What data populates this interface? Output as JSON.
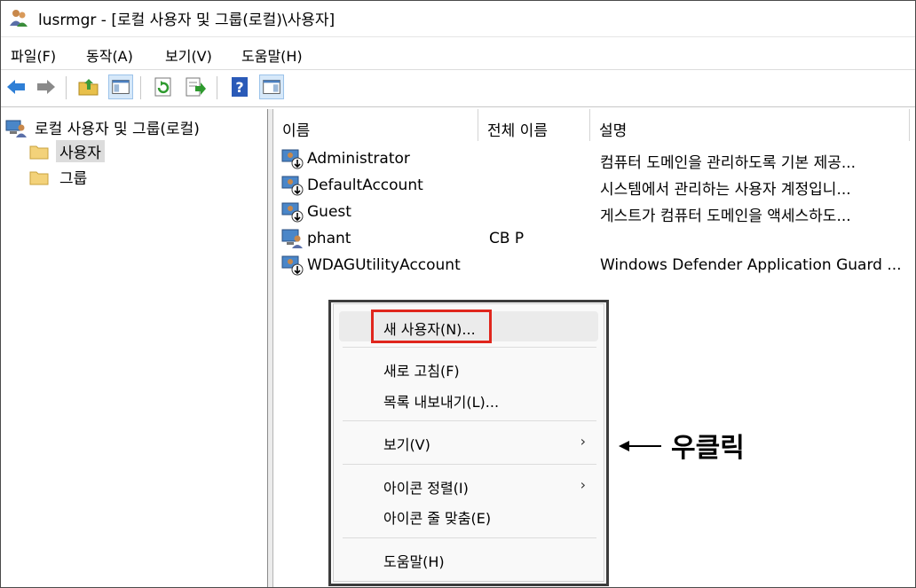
{
  "window": {
    "title": "lusrmgr - [로컬 사용자 및 그룹(로컬)\\사용자]"
  },
  "menubar": [
    {
      "label": "파일(F)"
    },
    {
      "label": "동작(A)"
    },
    {
      "label": "보기(V)"
    },
    {
      "label": "도움말(H)"
    }
  ],
  "tree": {
    "root": "로컬 사용자 및 그룹(로컬)",
    "children": [
      "사용자",
      "그룹"
    ],
    "selected": "사용자"
  },
  "list": {
    "columns": [
      "이름",
      "전체 이름",
      "설명"
    ],
    "rows": [
      {
        "name": "Administrator",
        "full_name": "",
        "description": "컴퓨터 도메인을 관리하도록 기본 제공..."
      },
      {
        "name": "DefaultAccount",
        "full_name": "",
        "description": "시스템에서 관리하는 사용자 계정입니..."
      },
      {
        "name": "Guest",
        "full_name": "",
        "description": "게스트가 컴퓨터 도메인을 액세스하도..."
      },
      {
        "name": "phant",
        "full_name": "CB P",
        "description": ""
      },
      {
        "name": "WDAGUtilityAccount",
        "full_name": "",
        "description": "Windows Defender Application Guard ..."
      }
    ]
  },
  "context_menu": {
    "items": [
      {
        "label": "새 사용자(N)..."
      },
      {
        "label": "새로 고침(F)"
      },
      {
        "label": "목록 내보내기(L)..."
      },
      {
        "label": "보기(V)",
        "submenu_glyph": "›"
      },
      {
        "label": "아이콘 정렬(I)",
        "submenu_glyph": "›"
      },
      {
        "label": "아이콘 줄 맞춤(E)"
      },
      {
        "label": "도움말(H)"
      }
    ]
  },
  "annotation": {
    "text": "우클릭"
  },
  "colors": {
    "highlight": "#e0261d",
    "selection": "#dcdcdc",
    "menu_bg": "#f9f9f9"
  }
}
